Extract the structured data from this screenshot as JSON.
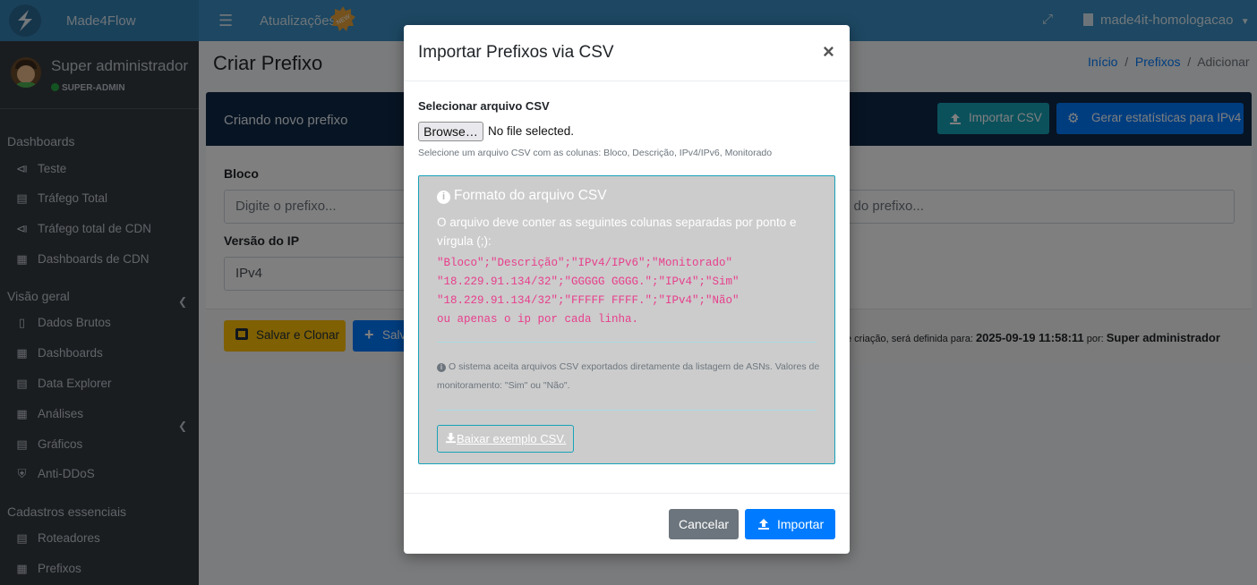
{
  "app": {
    "brand": "Made4Flow",
    "updates_label": "Atualizações",
    "new_badge": "NEW",
    "tenant": "made4it-homologacao"
  },
  "user": {
    "name": "Super administrador",
    "role": "SUPER-ADMIN"
  },
  "sidebar": {
    "sections": [
      {
        "title": "Dashboards",
        "items": [
          {
            "label": "Teste",
            "icon": "broadcast-icon"
          },
          {
            "label": "Tráfego Total",
            "icon": "chart-icon"
          },
          {
            "label": "Tráfego total de CDN",
            "icon": "broadcast-icon"
          },
          {
            "label": "Dashboards de CDN",
            "icon": "network-icon",
            "expandable": true
          }
        ]
      },
      {
        "title": "Visão geral",
        "items": [
          {
            "label": "Dados Brutos",
            "icon": "file-icon"
          },
          {
            "label": "Dashboards",
            "icon": "calendar-icon"
          },
          {
            "label": "Data Explorer",
            "icon": "file-alt-icon",
            "expandable": true
          },
          {
            "label": "Análises",
            "icon": "grid-icon"
          },
          {
            "label": "Gráficos",
            "icon": "bar-chart-icon"
          },
          {
            "label": "Anti-DDoS",
            "icon": "shield-icon"
          }
        ]
      },
      {
        "title": "Cadastros essenciais",
        "items": [
          {
            "label": "Roteadores",
            "icon": "server-icon"
          },
          {
            "label": "Prefixos",
            "icon": "network-icon"
          }
        ]
      }
    ]
  },
  "page": {
    "title": "Criar Prefixo",
    "breadcrumb": [
      "Início",
      "Prefixos",
      "Adicionar"
    ],
    "card_title": "Criando novo prefixo",
    "import_csv_button": "Importar CSV",
    "ipv4_stats_button": "Gerar estatísticas para IPv4",
    "bloco_label": "Bloco",
    "bloco_placeholder": "Digite o prefixo...",
    "desc_placeholder_fragment": "o do prefixo...",
    "ip_version_label": "Versão do IP",
    "ip_version_value": "IPv4",
    "save_clone_button": "Salvar e Clonar",
    "save_button_fragment": "Salv",
    "footnote_prefix": "e criação, será definida para:",
    "footnote_date": "2025-09-19 11:58:11",
    "footnote_por": "por:",
    "footnote_user": "Super administrador"
  },
  "modal": {
    "title": "Importar Prefixos via CSV",
    "file_label": "Selecionar arquivo CSV",
    "browse_button": "Browse…",
    "no_file": "No file selected.",
    "hint": "Selecione um arquivo CSV com as colunas: Bloco, Descrição, IPv4/IPv6, Monitorado",
    "info_title": "Formato do arquivo CSV",
    "info_desc": "O arquivo deve conter as seguintes colunas separadas por ponto e vírgula (;):",
    "code_lines": [
      "\"Bloco\";\"Descrição\";\"IPv4/IPv6\";\"Monitorado\"",
      "\"18.229.91.134/32\";\"GGGGG GGGG.\";\"IPv4\";\"Sim\"",
      "\"18.229.91.134/32\";\"FFFFF FFFF.\";\"IPv4\";\"Não\"",
      "ou apenas o ip por cada linha."
    ],
    "note": "O sistema aceita arquivos CSV exportados diretamente da listagem de ASNs. Valores de monitoramento: \"Sim\" ou \"Não\".",
    "download_button": "Baixar exemplo CSV.",
    "cancel_button": "Cancelar",
    "import_button": "Importar"
  },
  "colors": {
    "primary": "#007bff",
    "info": "#17a2b8",
    "warning": "#ffc107",
    "secondary": "#6c757d",
    "sidebar": "#343a40",
    "topbar": "#3a8fc4",
    "code": "#e83e8c"
  }
}
